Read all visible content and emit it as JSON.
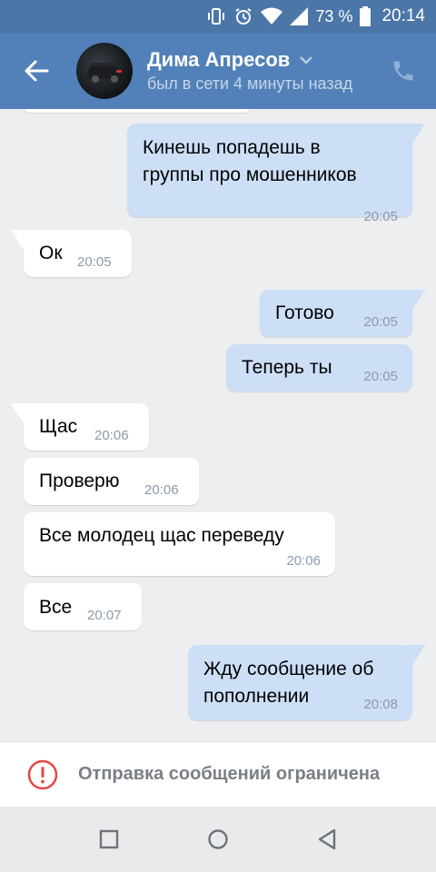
{
  "status_bar": {
    "battery_percent": "73 %",
    "time": "20:14",
    "icons": [
      "vibrate-icon",
      "alarm-icon",
      "wifi-icon",
      "signal-icon",
      "battery-icon"
    ]
  },
  "header": {
    "back_icon": "arrow-left-icon",
    "contact_name": "Дима Апресов",
    "contact_status": "был в сети 4 минуты назад",
    "dropdown_icon": "chevron-down-icon",
    "call_icon": "phone-icon"
  },
  "messages": [
    {
      "dir": "out",
      "lines": [
        "Кинешь  попадешь в",
        "группы про мошенников"
      ],
      "time": "20:05"
    },
    {
      "dir": "in",
      "lines": [
        "Ок"
      ],
      "time": "20:05"
    },
    {
      "dir": "out",
      "lines": [
        "Готово"
      ],
      "time": "20:05"
    },
    {
      "dir": "out",
      "lines": [
        "Теперь ты"
      ],
      "time": "20:05"
    },
    {
      "dir": "in",
      "lines": [
        "Щас"
      ],
      "time": "20:06"
    },
    {
      "dir": "in",
      "lines": [
        "Проверю"
      ],
      "time": "20:06"
    },
    {
      "dir": "in",
      "lines": [
        "Все молодец щас переведу"
      ],
      "time": "20:06"
    },
    {
      "dir": "in",
      "lines": [
        "Все"
      ],
      "time": "20:07"
    },
    {
      "dir": "out",
      "lines": [
        "Жду сообщение об",
        "пополнении"
      ],
      "time": "20:08"
    }
  ],
  "restriction": {
    "icon": "alert-circle-icon",
    "text": "Отправка сообщений ограничена",
    "accent": "#e64646"
  },
  "nav": {
    "icons": [
      "recent-apps-icon",
      "home-icon",
      "back-triangle-icon"
    ]
  },
  "colors": {
    "header": "#5181b8",
    "status_bar": "#4a76a8",
    "chat_bg": "#edeef0",
    "bubble_in": "#ffffff",
    "bubble_out": "#cddff6"
  }
}
